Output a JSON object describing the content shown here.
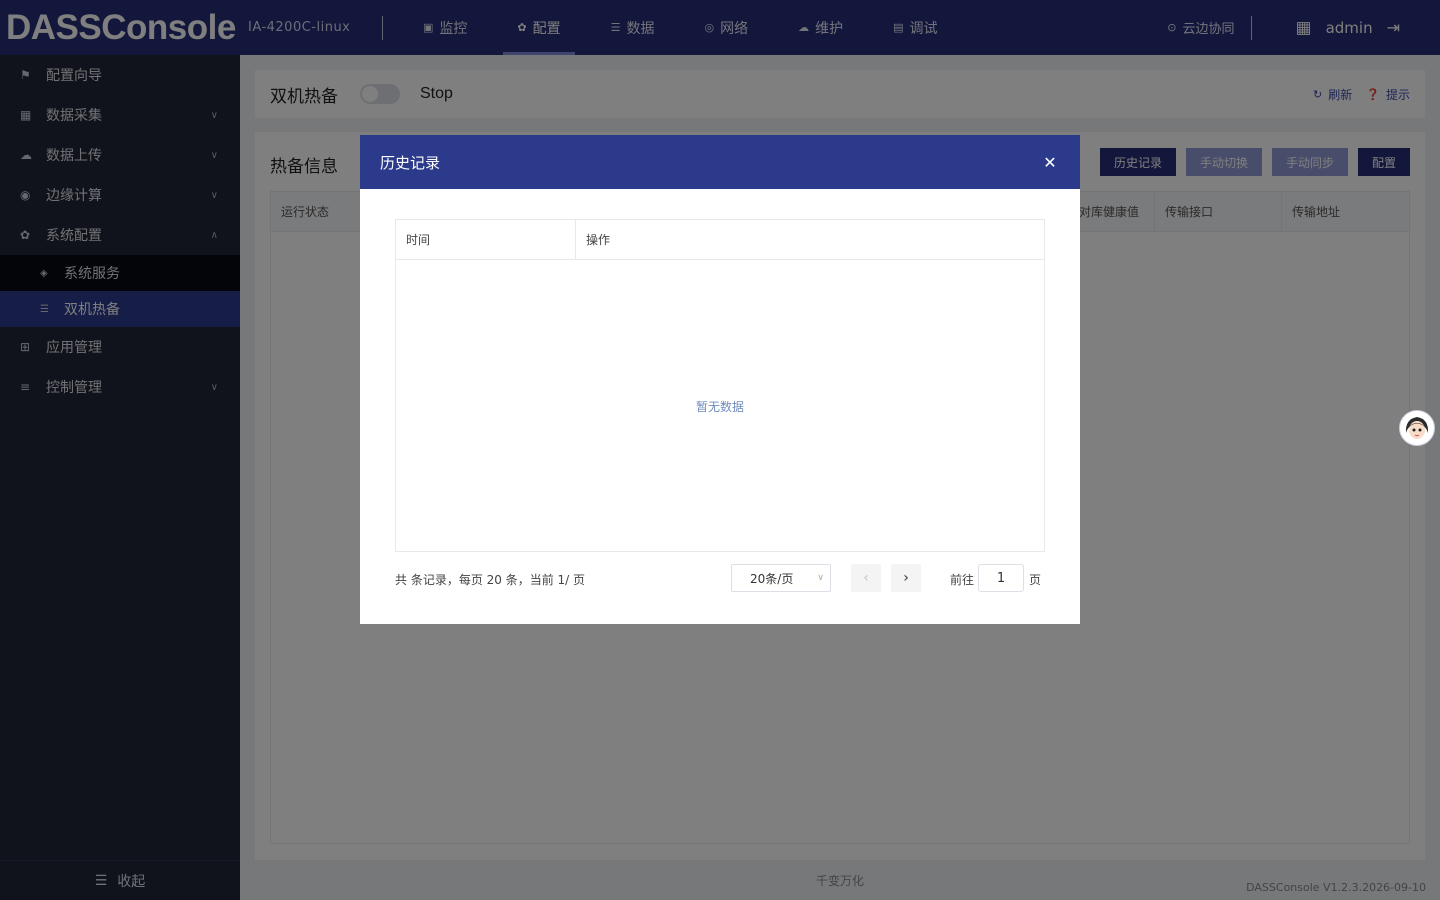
{
  "header": {
    "brand": "DASSConsole",
    "device": "IA-4200C-linux",
    "nav": [
      {
        "label": "监控",
        "icon": "monitor-icon",
        "glyph": "▣"
      },
      {
        "label": "配置",
        "icon": "gear-icon",
        "glyph": "✿",
        "active": true
      },
      {
        "label": "数据",
        "icon": "database-icon",
        "glyph": "☰"
      },
      {
        "label": "网络",
        "icon": "globe-icon",
        "glyph": "◎"
      },
      {
        "label": "维护",
        "icon": "cloud-icon",
        "glyph": "☁"
      },
      {
        "label": "调试",
        "icon": "debug-icon",
        "glyph": "▤"
      }
    ],
    "cloud_label": "云边协同",
    "user": "admin"
  },
  "sidebar": {
    "items": [
      {
        "label": "配置向导",
        "icon": "guide-icon"
      },
      {
        "label": "数据采集",
        "icon": "collect-icon"
      },
      {
        "label": "数据上传",
        "icon": "upload-icon"
      },
      {
        "label": "边缘计算",
        "icon": "edge-icon"
      },
      {
        "label": "系统配置",
        "icon": "settings-icon"
      },
      {
        "label": "应用管理",
        "icon": "apps-icon"
      },
      {
        "label": "控制管理",
        "icon": "control-icon"
      }
    ],
    "sub_items": [
      {
        "label": "系统服务"
      },
      {
        "label": "双机热备"
      }
    ],
    "collapse_label": "收起"
  },
  "page": {
    "title": "双机热备",
    "state": "Stop",
    "refresh_label": "刷新",
    "tip_label": "提示",
    "section_title": "热备信息",
    "buttons": {
      "history": "历史记录",
      "manual_switch": "手动切换",
      "manual_sync": "手动同步",
      "config": "配置"
    },
    "columns": [
      "运行状态",
      "对库健康值",
      "传输接口",
      "传输地址"
    ]
  },
  "dialog": {
    "title": "历史记录",
    "columns": [
      "时间",
      "操作"
    ],
    "empty_text": "暂无数据",
    "pager": {
      "summary": "共 条记录，每页 20 条，当前 1/ 页",
      "page_size": "20条/页",
      "goto_label": "前往",
      "goto_value": "1",
      "page_unit": "页"
    }
  },
  "footer": {
    "company": "千变万化",
    "version": "DASSConsole V1.2.3.2026-09-10"
  }
}
